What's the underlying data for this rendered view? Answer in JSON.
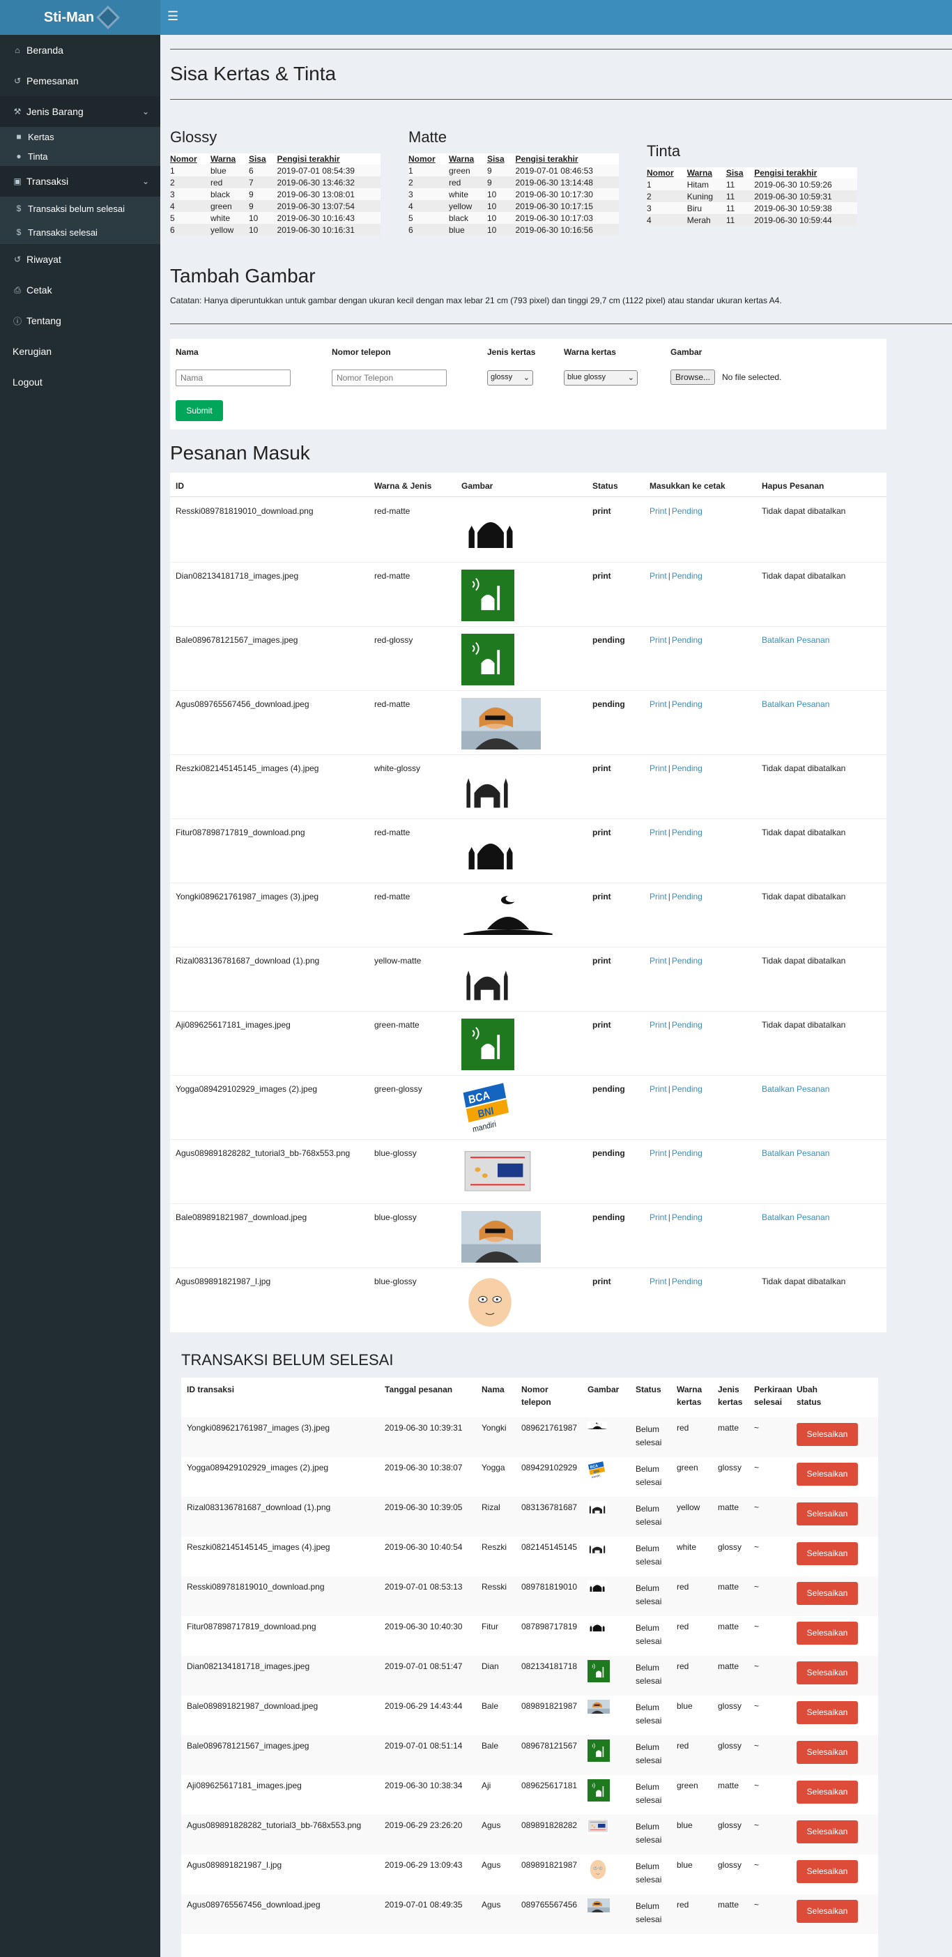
{
  "brand": "Sti-Man",
  "menu_icon": "bars-icon",
  "sidebar": {
    "items": [
      {
        "label": "Beranda",
        "icon": "home-icon"
      },
      {
        "label": "Pemesanan",
        "icon": "history-icon"
      },
      {
        "label": "Jenis Barang",
        "icon": "tools-icon"
      },
      {
        "label": "Kertas",
        "icon": "square-icon"
      },
      {
        "label": "Tinta",
        "icon": "drop-icon"
      },
      {
        "label": "Transaksi",
        "icon": "money-icon"
      },
      {
        "label": "Transaksi belum selesai",
        "icon": "dollar-icon"
      },
      {
        "label": "Transaksi selesai",
        "icon": "dollar-icon"
      },
      {
        "label": "Riwayat",
        "icon": "history-icon"
      },
      {
        "label": "Cetak",
        "icon": "print-icon"
      },
      {
        "label": "Tentang",
        "icon": "info-icon"
      },
      {
        "label": "Kerugian",
        "icon": ""
      },
      {
        "label": "Logout",
        "icon": ""
      }
    ]
  },
  "page_title": "Sisa Kertas & Tinta",
  "headers_stock": [
    "Nomor",
    "Warna",
    "Sisa",
    "Pengisi terakhir"
  ],
  "glossy": {
    "title": "Glossy",
    "rows": [
      [
        "1",
        "blue",
        "6",
        "2019-07-01 08:54:39"
      ],
      [
        "2",
        "red",
        "7",
        "2019-06-30 13:46:32"
      ],
      [
        "3",
        "black",
        "9",
        "2019-06-30 13:08:01"
      ],
      [
        "4",
        "green",
        "9",
        "2019-06-30 13:07:54"
      ],
      [
        "5",
        "white",
        "10",
        "2019-06-30 10:16:43"
      ],
      [
        "6",
        "yellow",
        "10",
        "2019-06-30 10:16:31"
      ]
    ]
  },
  "matte": {
    "title": "Matte",
    "rows": [
      [
        "1",
        "green",
        "9",
        "2019-07-01 08:46:53"
      ],
      [
        "2",
        "red",
        "9",
        "2019-06-30 13:14:48"
      ],
      [
        "3",
        "white",
        "10",
        "2019-06-30 10:17:30"
      ],
      [
        "4",
        "yellow",
        "10",
        "2019-06-30 10:17:15"
      ],
      [
        "5",
        "black",
        "10",
        "2019-06-30 10:17:03"
      ],
      [
        "6",
        "blue",
        "10",
        "2019-06-30 10:16:56"
      ]
    ]
  },
  "tinta": {
    "title": "Tinta",
    "rows": [
      [
        "1",
        "Hitam",
        "11",
        "2019-06-30 10:59:26"
      ],
      [
        "2",
        "Kuning",
        "11",
        "2019-06-30 10:59:31"
      ],
      [
        "3",
        "Biru",
        "11",
        "2019-06-30 10:59:38"
      ],
      [
        "4",
        "Merah",
        "11",
        "2019-06-30 10:59:44"
      ]
    ]
  },
  "tambah": {
    "title": "Tambah Gambar",
    "note": "Catatan: Hanya diperuntukkan untuk gambar dengan ukuran kecil dengan max lebar 21 cm (793 pixel) dan tinggi 29,7 cm (1122 pixel) atau standar ukuran kertas A4.",
    "labels": {
      "nama": "Nama",
      "telepon": "Nomor telepon",
      "jenis": "Jenis kertas",
      "warna": "Warna kertas",
      "gambar": "Gambar"
    },
    "placeholders": {
      "nama": "Nama",
      "telepon": "Nomor Telepon"
    },
    "jenis_value": "glossy",
    "warna_value": "blue glossy",
    "browse": "Browse...",
    "no_file": "No file selected.",
    "submit": "Submit"
  },
  "pesanan": {
    "title": "Pesanan Masuk",
    "headers": [
      "ID",
      "Warna & Jenis",
      "Gambar",
      "Status",
      "Masukkan ke cetak",
      "Hapus Pesanan"
    ],
    "print": "Print",
    "sep": "|",
    "pending": "Pending",
    "rows": [
      {
        "id": "Resski089781819010_download.png",
        "wj": "red-matte",
        "status": "print",
        "hapus": "Tidak dapat dibatalkan",
        "thumb": "mosque"
      },
      {
        "id": "Dian082134181718_images.jpeg",
        "wj": "red-matte",
        "status": "print",
        "hapus": "Tidak dapat dibatalkan",
        "thumb": "green"
      },
      {
        "id": "Bale089678121567_images.jpeg",
        "wj": "red-glossy",
        "status": "pending",
        "hapus": "Batalkan Pesanan",
        "thumb": "green"
      },
      {
        "id": "Agus089765567456_download.jpeg",
        "wj": "red-matte",
        "status": "pending",
        "hapus": "Batalkan Pesanan",
        "thumb": "photo"
      },
      {
        "id": "Reszki082145145145_images (4).jpeg",
        "wj": "white-glossy",
        "status": "print",
        "hapus": "Tidak dapat dibatalkan",
        "thumb": "mosque2"
      },
      {
        "id": "Fitur087898717819_download.png",
        "wj": "red-matte",
        "status": "print",
        "hapus": "Tidak dapat dibatalkan",
        "thumb": "mosque"
      },
      {
        "id": "Yongki089621761987_images (3).jpeg",
        "wj": "red-matte",
        "status": "print",
        "hapus": "Tidak dapat dibatalkan",
        "thumb": "crescent"
      },
      {
        "id": "Rizal083136781687_download (1).png",
        "wj": "yellow-matte",
        "status": "print",
        "hapus": "Tidak dapat dibatalkan",
        "thumb": "mosque2"
      },
      {
        "id": "Aji089625617181_images.jpeg",
        "wj": "green-matte",
        "status": "print",
        "hapus": "Tidak dapat dibatalkan",
        "thumb": "green"
      },
      {
        "id": "Yogga089429102929_images (2).jpeg",
        "wj": "green-glossy",
        "status": "pending",
        "hapus": "Batalkan Pesanan",
        "thumb": "bank"
      },
      {
        "id": "Agus089891828282_tutorial3_bb-768x553.png",
        "wj": "blue-glossy",
        "status": "pending",
        "hapus": "Batalkan Pesanan",
        "thumb": "circuit"
      },
      {
        "id": "Bale089891821987_download.jpeg",
        "wj": "blue-glossy",
        "status": "pending",
        "hapus": "Batalkan Pesanan",
        "thumb": "photo"
      },
      {
        "id": "Agus089891821987_l.jpg",
        "wj": "blue-glossy",
        "status": "print",
        "hapus": "Tidak dapat dibatalkan",
        "thumb": "cartoon"
      }
    ]
  },
  "transaksi": {
    "title": "TRANSAKSI BELUM SELESAI",
    "headers": [
      "ID transaksi",
      "Tanggal pesanan",
      "Nama",
      "Nomor telepon",
      "Gambar",
      "Status",
      "Warna kertas",
      "Jenis kertas",
      "Perkiraan selesai",
      "Ubah status"
    ],
    "status": "Belum selesai",
    "estimate": "~",
    "button": "Selesaikan",
    "rows": [
      {
        "id": "Yongki089621761987_images (3).jpeg",
        "tgl": "2019-06-30 10:39:31",
        "nama": "Yongki",
        "telp": "089621761987",
        "warna": "red",
        "jenis": "matte",
        "thumb": "crescent"
      },
      {
        "id": "Yogga089429102929_images (2).jpeg",
        "tgl": "2019-06-30 10:38:07",
        "nama": "Yogga",
        "telp": "089429102929",
        "warna": "green",
        "jenis": "glossy",
        "thumb": "bank"
      },
      {
        "id": "Rizal083136781687_download (1).png",
        "tgl": "2019-06-30 10:39:05",
        "nama": "Rizal",
        "telp": "083136781687",
        "warna": "yellow",
        "jenis": "matte",
        "thumb": "mosque2"
      },
      {
        "id": "Reszki082145145145_images (4).jpeg",
        "tgl": "2019-06-30 10:40:54",
        "nama": "Reszki",
        "telp": "082145145145",
        "warna": "white",
        "jenis": "glossy",
        "thumb": "mosque2"
      },
      {
        "id": "Resski089781819010_download.png",
        "tgl": "2019-07-01 08:53:13",
        "nama": "Resski",
        "telp": "089781819010",
        "warna": "red",
        "jenis": "matte",
        "thumb": "mosque"
      },
      {
        "id": "Fitur087898717819_download.png",
        "tgl": "2019-06-30 10:40:30",
        "nama": "Fitur",
        "telp": "087898717819",
        "warna": "red",
        "jenis": "matte",
        "thumb": "mosque"
      },
      {
        "id": "Dian082134181718_images.jpeg",
        "tgl": "2019-07-01 08:51:47",
        "nama": "Dian",
        "telp": "082134181718",
        "warna": "red",
        "jenis": "matte",
        "thumb": "green"
      },
      {
        "id": "Bale089891821987_download.jpeg",
        "tgl": "2019-06-29 14:43:44",
        "nama": "Bale",
        "telp": "089891821987",
        "warna": "blue",
        "jenis": "glossy",
        "thumb": "photo"
      },
      {
        "id": "Bale089678121567_images.jpeg",
        "tgl": "2019-07-01 08:51:14",
        "nama": "Bale",
        "telp": "089678121567",
        "warna": "red",
        "jenis": "glossy",
        "thumb": "green"
      },
      {
        "id": "Aji089625617181_images.jpeg",
        "tgl": "2019-06-30 10:38:34",
        "nama": "Aji",
        "telp": "089625617181",
        "warna": "green",
        "jenis": "matte",
        "thumb": "green"
      },
      {
        "id": "Agus089891828282_tutorial3_bb-768x553.png",
        "tgl": "2019-06-29 23:26:20",
        "nama": "Agus",
        "telp": "089891828282",
        "warna": "blue",
        "jenis": "glossy",
        "thumb": "circuit"
      },
      {
        "id": "Agus089891821987_l.jpg",
        "tgl": "2019-06-29 13:09:43",
        "nama": "Agus",
        "telp": "089891821987",
        "warna": "blue",
        "jenis": "glossy",
        "thumb": "cartoon"
      },
      {
        "id": "Agus089765567456_download.jpeg",
        "tgl": "2019-07-01 08:49:35",
        "nama": "Agus",
        "telp": "089765567456",
        "warna": "red",
        "jenis": "matte",
        "thumb": "photo"
      }
    ]
  }
}
